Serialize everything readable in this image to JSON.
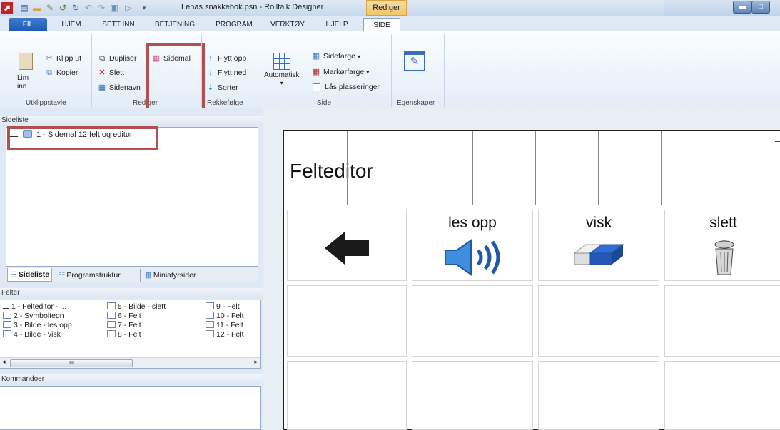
{
  "window": {
    "title": "Lenas snakkebok.psn - Rolltalk Designer",
    "context_tab": "Rediger",
    "minimize_glyph": "▬",
    "maximize_glyph": "□"
  },
  "tabs": [
    {
      "label": "FIL"
    },
    {
      "label": "HJEM"
    },
    {
      "label": "SETT INN"
    },
    {
      "label": "BETJENING"
    },
    {
      "label": "PROGRAM"
    },
    {
      "label": "VERKTØY"
    },
    {
      "label": "HJELP"
    },
    {
      "label": "SIDE",
      "active": true
    }
  ],
  "ribbon": {
    "clipboard": {
      "paste": "Lim inn",
      "cut": "Klipp ut",
      "copy": "Kopier",
      "group": "Utklippstavle"
    },
    "edit": {
      "duplicate": "Dupliser",
      "delete": "Slett",
      "pagename": "Sidenavn",
      "template": "Sidemal",
      "group": "Rediger"
    },
    "order": {
      "move_up": "Flytt opp",
      "move_down": "Flytt ned",
      "sort": "Sorter",
      "group": "Rekkefølge"
    },
    "page": {
      "automatic": "Automatisk",
      "page_color": "Sidefarge",
      "cursor_color": "Markørfarge",
      "lock": "Lås plasseringer",
      "group": "Side"
    },
    "properties": {
      "group": "Egenskaper"
    }
  },
  "left": {
    "pagelist_header": "Sideliste",
    "pages": [
      "1 - Sidemal 12 felt og editor"
    ],
    "view_tabs": [
      "Sideliste",
      "Programstruktur",
      "Miniatyrsider"
    ],
    "fields_header": "Felter",
    "fields": [
      [
        "1 - Felteditor - ...",
        "5 - Bilde - slett",
        "9 - Felt"
      ],
      [
        "2 - Symboltegn",
        "6 - Felt",
        "10 - Felt"
      ],
      [
        "3 - Bilde - les opp",
        "7 - Felt",
        "11 - Felt"
      ],
      [
        "4 - Bilde - visk",
        "8 - Felt",
        "12 - Felt"
      ]
    ],
    "scroll_glyph": "III",
    "commands_header": "Kommandoer"
  },
  "canvas": {
    "editor_text": "Felteditor",
    "cells": [
      {
        "label": "",
        "icon": "back-arrow-icon"
      },
      {
        "label": "les opp",
        "icon": "speaker-icon"
      },
      {
        "label": "visk",
        "icon": "eraser-icon"
      },
      {
        "label": "slett",
        "icon": "trash-icon"
      }
    ]
  },
  "colors": {
    "highlight_box": "#b24f4f",
    "fil_tab": "#2a6bc4",
    "context_tab": "#f1c667"
  }
}
